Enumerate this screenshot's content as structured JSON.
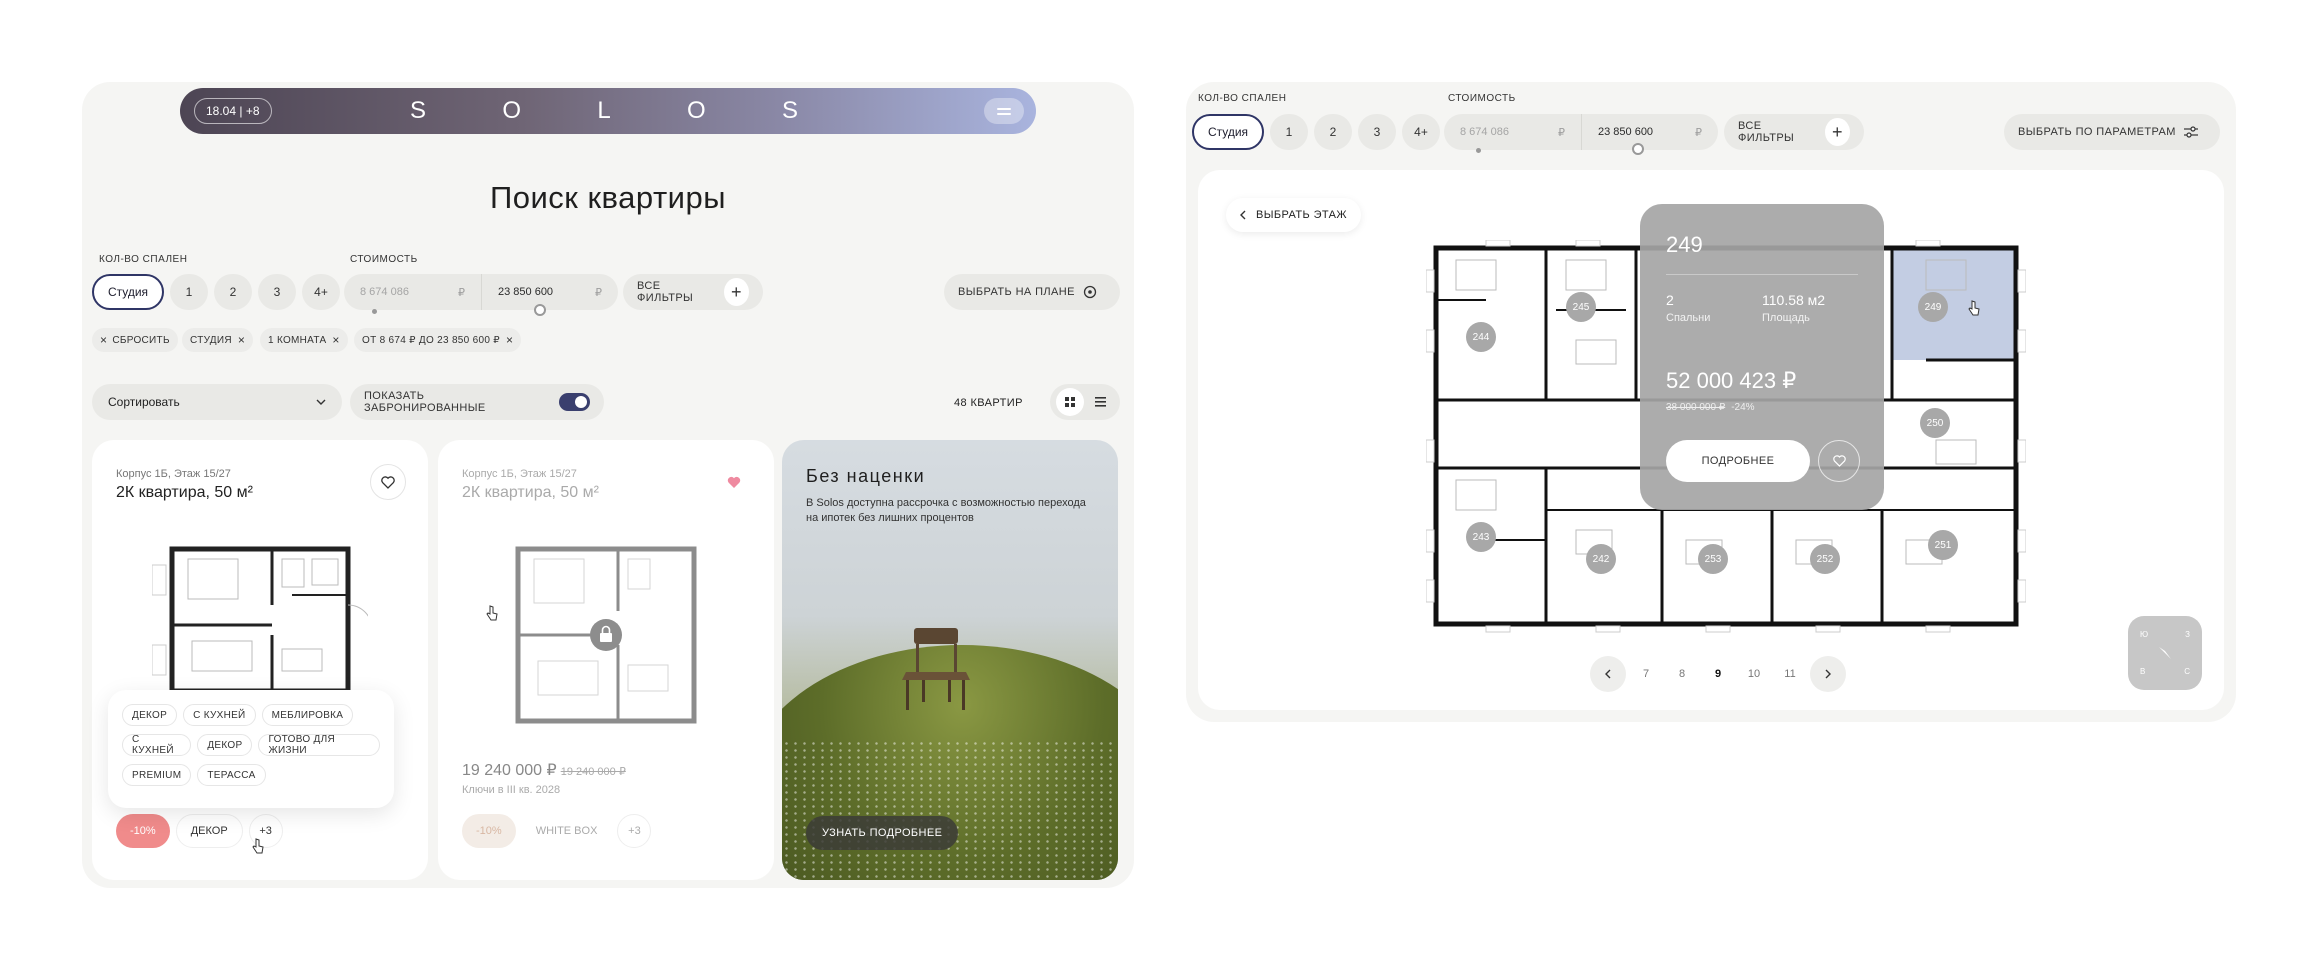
{
  "left": {
    "header": {
      "date_badge": "18.04 | +8",
      "logo_letters": [
        "S",
        "O",
        "L",
        "O",
        "S"
      ]
    },
    "page_title": "Поиск квартиры",
    "filters": {
      "bedrooms_label": "Кол-во спален",
      "bedrooms": [
        "Студия",
        "1",
        "2",
        "3",
        "4+"
      ],
      "price_label": "Стоимость",
      "price_from": "8 674 086",
      "price_to": "23 850 600",
      "currency": "₽",
      "all_filters": "Все фильтры",
      "choose_on_plan": "Выбрать на плане"
    },
    "active_chips": {
      "reset": "Сбросить",
      "items": [
        "Студия",
        "1 комната",
        "от 8 674 ₽ до 23 850 600 ₽"
      ]
    },
    "sort": {
      "label": "Сортировать",
      "show_booked": "Показать забронированные",
      "count": "48 квартир"
    },
    "cards": [
      {
        "meta": "Корпус 1Б, Этаж 15/27",
        "title": "2К квартира, 50 м²",
        "tags": [
          [
            "Декор",
            "С кухней",
            "Меблировка"
          ],
          [
            "С кухней",
            "Декор",
            "Готово для жизни"
          ],
          [
            "Premium",
            "Терасса"
          ]
        ],
        "sale": "-10%",
        "finish": "Декор",
        "more": "+3"
      },
      {
        "meta": "Корпус 1Б, Этаж 15/27",
        "title": "2К квартира, 50 м²",
        "price": "19 240 000 ₽",
        "old_price": "19 240 000 ₽",
        "keys": "Ключи в III кв. 2028",
        "sale": "-10%",
        "finish": "White box",
        "more": "+3"
      }
    ],
    "promo": {
      "title": "Без наценки",
      "text": "В Solos доступна рассрочка с возможностью перехода на ипотек без лишних процентов",
      "button": "Узнать подробнее"
    }
  },
  "right": {
    "filters": {
      "bedrooms_label": "Кол-во спален",
      "bedrooms": [
        "Студия",
        "1",
        "2",
        "3",
        "4+"
      ],
      "price_label": "Стоимость",
      "price_from": "8 674 086",
      "price_to": "23 850 600",
      "currency": "₽",
      "all_filters": "Все фильтры",
      "by_params": "Выбрать по параметрам"
    },
    "back": "Выбрать этаж",
    "popup": {
      "number": "249",
      "bedrooms_value": "2",
      "bedrooms_label": "Спальни",
      "area_value": "110.58 м2",
      "area_label": "Площадь",
      "price": "52 000 423 ₽",
      "old_price": "38 000 000 ₽",
      "discount": "-24%",
      "more": "Подробнее"
    },
    "units": [
      "244",
      "245",
      "249",
      "250",
      "243",
      "242",
      "253",
      "252",
      "251"
    ],
    "pager": {
      "pages": [
        "7",
        "8",
        "9",
        "10",
        "11"
      ],
      "current": "9"
    },
    "compass": {
      "n": "Ю",
      "e": "З",
      "w": "В",
      "s": "С"
    }
  },
  "colors": {
    "accent": "#2f3566",
    "sale": "#f08b8b",
    "highlight": "#c3cde3"
  }
}
